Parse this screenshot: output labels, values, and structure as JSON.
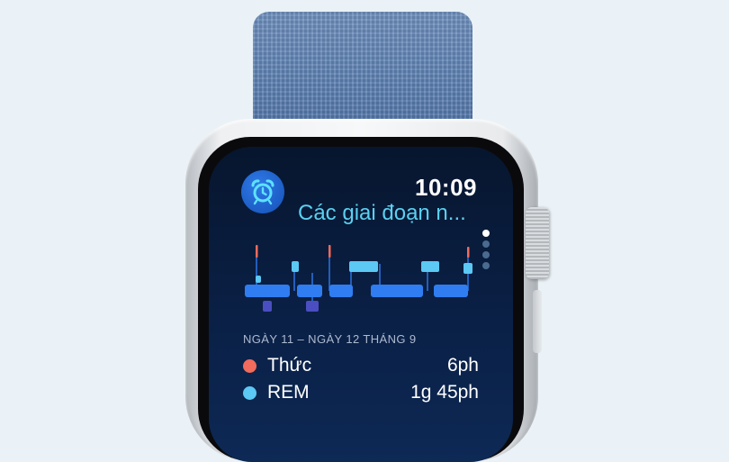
{
  "watch": {
    "time": "10:09",
    "app_title": "Các giai đoạn n...",
    "app_icon": "alarm-clock-icon",
    "page_indicator": {
      "count": 4,
      "active": 0
    }
  },
  "sleep_chart": {
    "date_range": "NGÀY 11 – NGÀY 12 THÁNG 9"
  },
  "stages": [
    {
      "label": "Thức",
      "value": "6ph",
      "color": "#f26b5c"
    },
    {
      "label": "REM",
      "value": "1g 45ph",
      "color": "#5cc8f4"
    }
  ],
  "colors": {
    "band": "#5b7fb1",
    "title": "#5bd0f0",
    "awake": "#f26b5c",
    "rem": "#5cc8f4",
    "core": "#2f7df0",
    "deep": "#4a4ec0"
  }
}
